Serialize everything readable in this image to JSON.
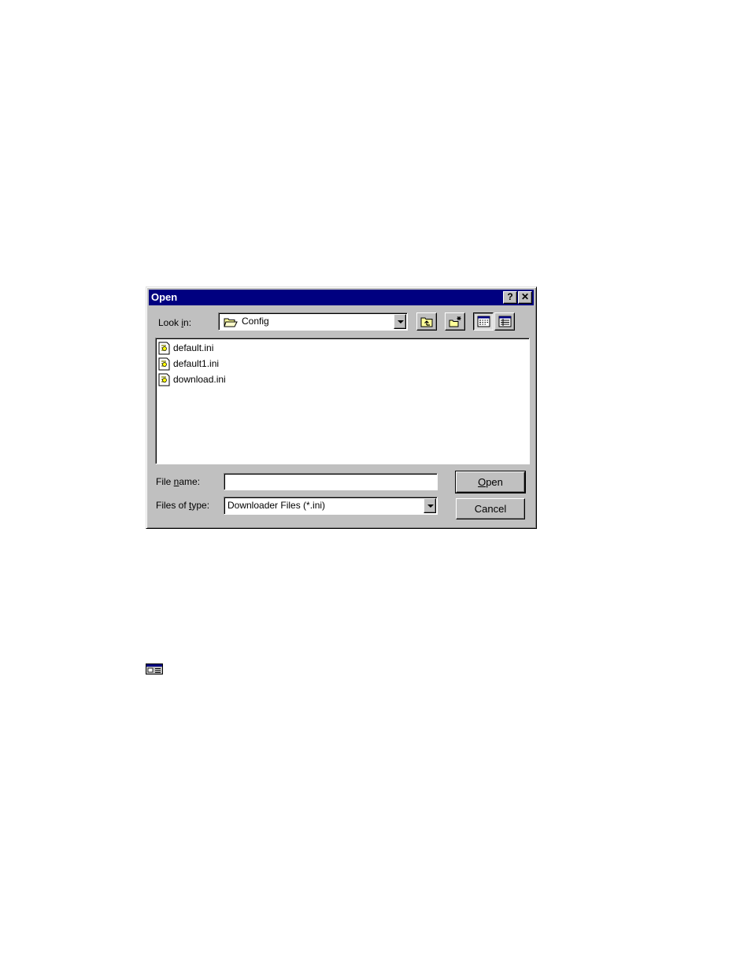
{
  "dialog": {
    "title": "Open",
    "help_button": "?",
    "close_button": "✕",
    "look_in": {
      "label_pre": "Look ",
      "label_key": "i",
      "label_post": "n:",
      "value": "Config"
    },
    "files": [
      {
        "name": "default.ini"
      },
      {
        "name": "default1.ini"
      },
      {
        "name": "download.ini"
      }
    ],
    "file_name": {
      "label_pre": "File ",
      "label_key": "n",
      "label_post": "ame:",
      "value": ""
    },
    "files_of_type": {
      "label_pre": "Files of ",
      "label_key": "t",
      "label_post": "ype:",
      "value": "Downloader Files (*.ini)"
    },
    "open_button": {
      "key": "O",
      "rest": "pen"
    },
    "cancel_button": "Cancel"
  },
  "colors": {
    "titlebar": "#000080",
    "face": "#c0c0c0",
    "folder": "#ffff99"
  }
}
